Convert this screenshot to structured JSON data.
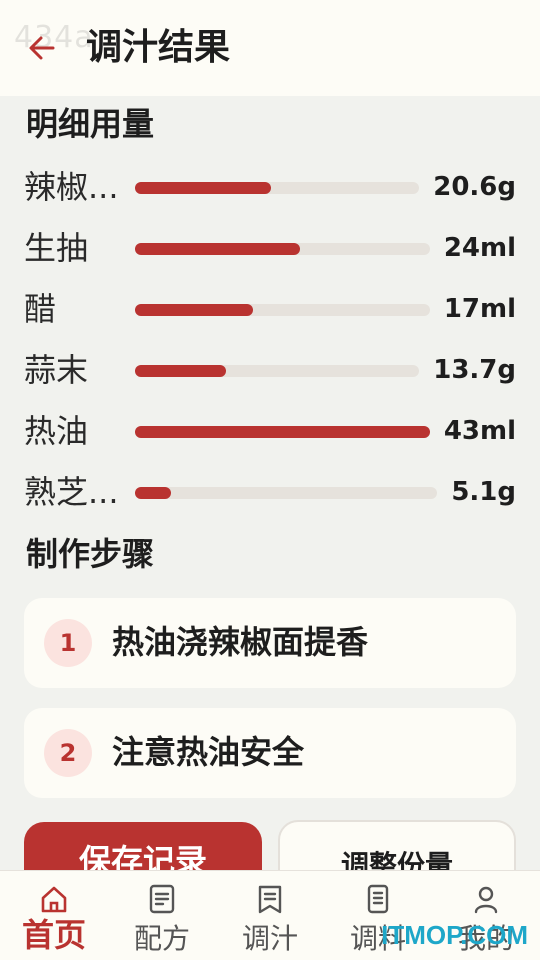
{
  "header": {
    "title": "调汁结果",
    "watermark": "434a",
    "back_icon": "arrow-left-icon"
  },
  "details": {
    "title": "明细用量",
    "items": [
      {
        "name": "辣椒...",
        "value": "20.6g",
        "fill": 0.48
      },
      {
        "name": "生抽",
        "value": "24ml",
        "fill": 0.56
      },
      {
        "name": "醋",
        "value": "17ml",
        "fill": 0.4
      },
      {
        "name": "蒜末",
        "value": "13.7g",
        "fill": 0.32
      },
      {
        "name": "热油",
        "value": "43ml",
        "fill": 1.0
      },
      {
        "name": "熟芝...",
        "value": "5.1g",
        "fill": 0.12
      }
    ]
  },
  "steps": {
    "title": "制作步骤",
    "items": [
      {
        "num": "1",
        "text": "热油浇辣椒面提香"
      },
      {
        "num": "2",
        "text": "注意热油安全"
      }
    ]
  },
  "actions": {
    "save_label": "保存记录",
    "adjust_label": "调整份量"
  },
  "tabbar": {
    "tabs": [
      {
        "label": "首页",
        "icon": "home-icon",
        "active": true
      },
      {
        "label": "配方",
        "icon": "document-icon",
        "active": false
      },
      {
        "label": "调汁",
        "icon": "bookmark-icon",
        "active": false
      },
      {
        "label": "调料",
        "icon": "list-icon",
        "active": false
      },
      {
        "label": "我的",
        "icon": "user-icon",
        "active": false
      }
    ]
  },
  "brand_watermark": "ITMOP.COM",
  "colors": {
    "accent": "#b93330",
    "background": "#f1f2ee",
    "surface": "#fdfcf6",
    "track": "#e6e2dc"
  }
}
